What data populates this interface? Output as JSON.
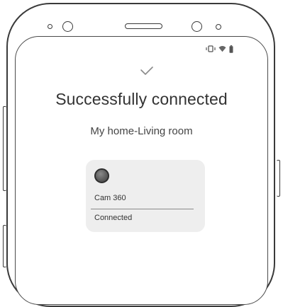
{
  "header": {
    "title": "Successfully connected",
    "subtitle": "My home-Living room"
  },
  "device": {
    "name": "Cam 360",
    "status": "Connected"
  },
  "icons": {
    "check": "checkmark-icon",
    "camera": "camera-dot-icon",
    "vibrate": "vibrate-icon",
    "wifi": "wifi-icon",
    "battery": "battery-icon"
  },
  "colors": {
    "card_background": "#eeeeee",
    "frame": "#3a3a3a",
    "text": "#333333"
  }
}
